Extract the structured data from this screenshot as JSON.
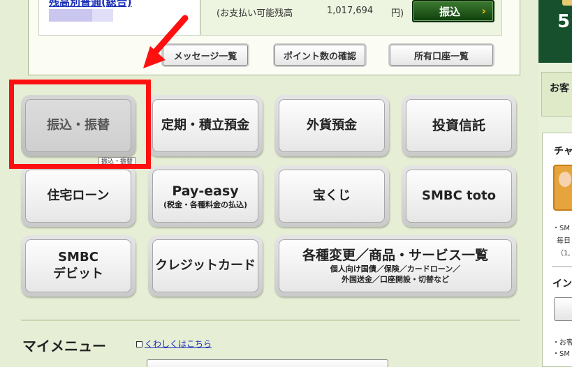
{
  "account": {
    "name_link": "残高別普通(総合)",
    "balance_label": "(お支払い可能残高",
    "balance_value": "1,017,694",
    "balance_unit": "円)",
    "transfer_button": "振込",
    "transfer_chevron": "›"
  },
  "actions": {
    "messages": "メッセージ一覧",
    "points": "ポイント数の確認",
    "accounts": "所有口座一覧"
  },
  "menu": {
    "transfer": "振込・振替",
    "deposit": "定期・積立預金",
    "fx_deposit": "外貨預金",
    "investment": "投資信託",
    "mortgage": "住宅ローン",
    "payeasy": "Pay-easy",
    "payeasy_sub": "(税金・各種料金の払込)",
    "lottery": "宝くじ",
    "toto": "SMBC toto",
    "debit_line1": "SMBC",
    "debit_line2": "デビット",
    "credit": "クレジットカード",
    "services": "各種変更／商品・サービス一覧",
    "services_sub1": "個人向け国債／保険／カードローン／",
    "services_sub2": "外国送金／口座開設・切替など",
    "tooltip": "振込・振替"
  },
  "mymenu": {
    "title": "マイメニュー",
    "detail_link": "くわしくはこちら"
  },
  "sidebar": {
    "banner_num": "5",
    "box1_text": "お客",
    "chat_title": "チャ",
    "line1": "・SM",
    "line2": "毎日",
    "line3": "（1,",
    "info_title": "イン",
    "line4": "・お客",
    "line5": "・SM"
  },
  "colors": {
    "accent_green": "#17502c",
    "link_blue": "#1a2fb8",
    "annotation_red": "#ff1010"
  }
}
